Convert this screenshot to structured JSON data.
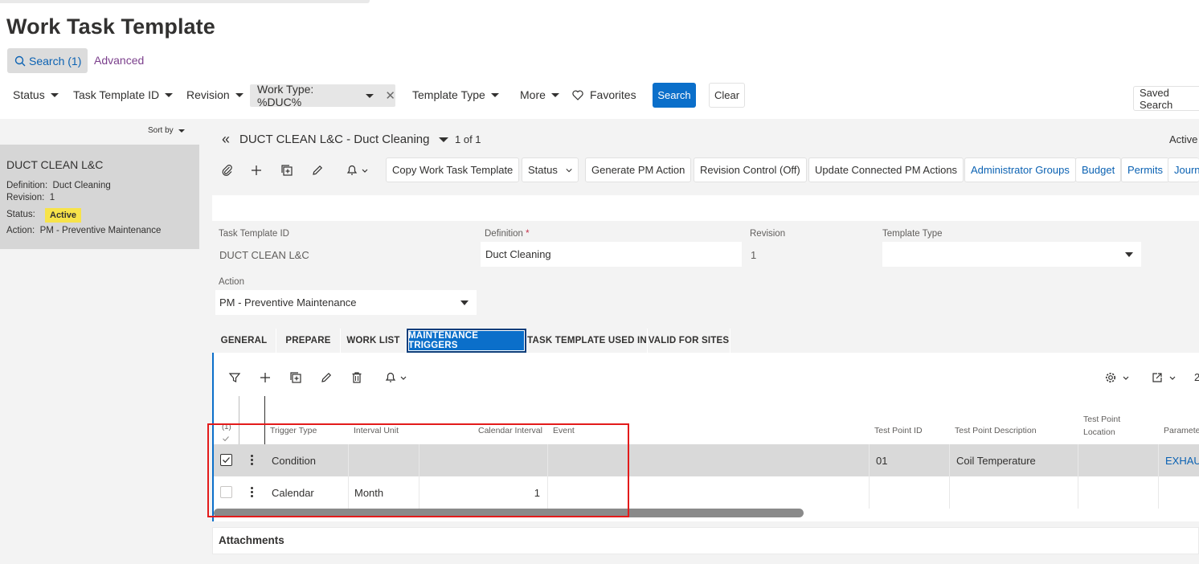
{
  "page": {
    "title": "Work Task Template"
  },
  "search_bar": {
    "search_label": "Search (1)",
    "advanced_label": "Advanced",
    "filters": [
      "Status",
      "Task Template ID",
      "Revision"
    ],
    "active_filter": "Work Type: %DUC%",
    "more_filters": [
      "Template Type",
      "More"
    ],
    "favorites_label": "Favorites",
    "search_button": "Search",
    "clear_button": "Clear",
    "saved_search_label": "Saved Search"
  },
  "list_panel": {
    "sort_label": "Sort by",
    "record": {
      "title": "DUCT CLEAN L&C",
      "definition_label": "Definition:",
      "definition_value": "Duct Cleaning",
      "revision_label": "Revision:",
      "revision_value": "1",
      "status_label": "Status:",
      "status_value": "Active",
      "action_label": "Action:",
      "action_value": "PM - Preventive Maintenance"
    }
  },
  "record_header": {
    "title": "DUCT CLEAN L&C - Duct Cleaning",
    "count": "1 of 1",
    "state": "Active"
  },
  "toolbar": {
    "buttons": [
      "Copy Work Task Template",
      "Status",
      "Generate PM Action",
      "Revision Control (Off)",
      "Update Connected PM Actions"
    ],
    "links": [
      "Administrator Groups",
      "Budget",
      "Permits",
      "Journ"
    ]
  },
  "form": {
    "task_template_id_label": "Task Template ID",
    "task_template_id_value": "DUCT CLEAN L&C",
    "definition_label": "Definition",
    "definition_required": "*",
    "definition_value": "Duct Cleaning",
    "revision_label": "Revision",
    "revision_value": "1",
    "template_type_label": "Template Type",
    "template_type_value": "",
    "action_label": "Action",
    "action_value": "PM - Preventive Maintenance"
  },
  "tabs": [
    "GENERAL",
    "PREPARE",
    "WORK LIST",
    "MAINTENANCE TRIGGERS",
    "TASK TEMPLATE USED IN",
    "VALID FOR SITES"
  ],
  "grid": {
    "selected_count": "(1)",
    "page_number": "2",
    "columns": {
      "trigger_type": "Trigger Type",
      "interval_unit": "Interval Unit",
      "calendar_interval": "Calendar Interval",
      "event": "Event",
      "test_point_id": "Test Point ID",
      "test_point_description": "Test Point Description",
      "test_point_location": "Test Point Location",
      "parameter": "Paramete"
    },
    "rows": [
      {
        "trigger_type": "Condition",
        "interval_unit": "",
        "calendar_interval": "",
        "event": "",
        "test_point_id": "01",
        "test_point_description": "Coil Temperature",
        "test_point_location": "",
        "parameter": "EXHAU",
        "checked": true
      },
      {
        "trigger_type": "Calendar",
        "interval_unit": "Month",
        "calendar_interval": "1",
        "event": "",
        "test_point_id": "",
        "test_point_description": "",
        "test_point_location": "",
        "parameter": "",
        "checked": false
      }
    ]
  },
  "attachments": {
    "title": "Attachments"
  },
  "colors": {
    "primary": "#0b6fca",
    "active_badge": "#f7e34a",
    "highlight": "#e31b1b",
    "link": "#0b62b3"
  }
}
